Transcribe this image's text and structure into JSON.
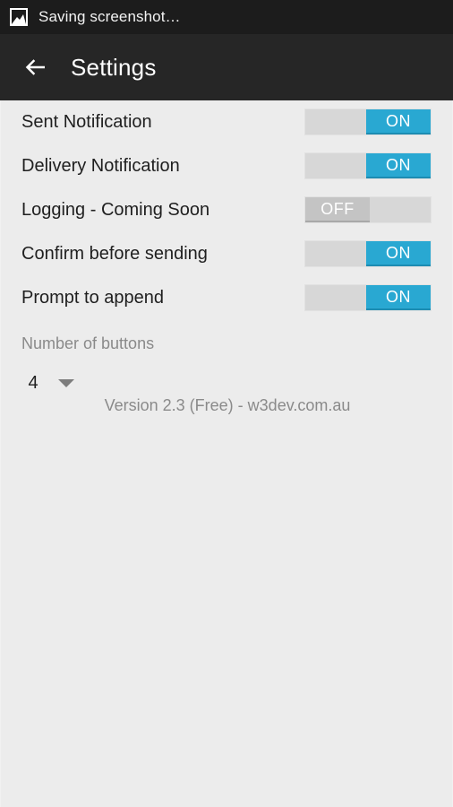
{
  "status_bar": {
    "icon": "screenshot-image-icon",
    "text": "Saving screenshot…",
    "background": "#1c1c1c",
    "text_color": "#f2f2f2"
  },
  "app_bar": {
    "back_icon": "arrow-left-icon",
    "title": "Settings",
    "background": "#262626",
    "title_color": "#ffffff"
  },
  "colors": {
    "accent_on": "#29a8d2",
    "track": "#d7d7d7",
    "thumb_off": "#c4c4c4",
    "page_background": "#ececec",
    "label": "#1f1f1f",
    "muted": "#8a8a8a"
  },
  "preferences": [
    {
      "label": "Sent Notification",
      "state": "ON",
      "state_label": "ON"
    },
    {
      "label": "Delivery Notification",
      "state": "ON",
      "state_label": "ON"
    },
    {
      "label": "Logging - Coming Soon",
      "state": "OFF",
      "state_label": "OFF"
    },
    {
      "label": "Confirm before sending",
      "state": "ON",
      "state_label": "ON"
    },
    {
      "label": "Prompt to append",
      "state": "ON",
      "state_label": "ON"
    }
  ],
  "spinner": {
    "label": "Number of buttons",
    "value": "4",
    "caret_icon": "chevron-down-icon"
  },
  "footer": {
    "version_text": "Version 2.3 (Free) - w3dev.com.au"
  }
}
